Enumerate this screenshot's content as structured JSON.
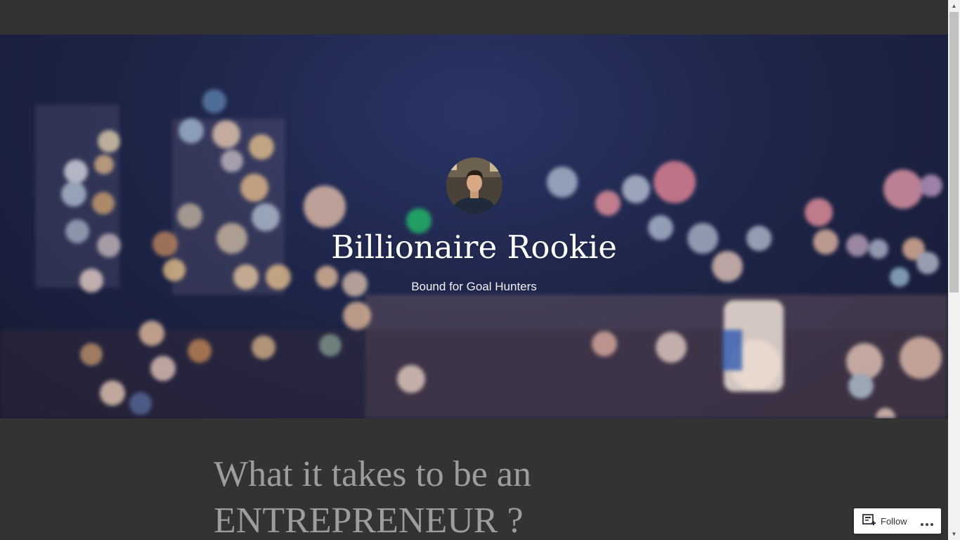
{
  "site": {
    "title": "Billionaire Rookie",
    "tagline": "Bound for Goal Hunters",
    "avatar_icon": "profile-photo"
  },
  "post": {
    "title": "What it takes to be an ENTREPRENEUR ?"
  },
  "follow_widget": {
    "follow_label": "Follow",
    "follow_icon": "reader-follow-icon",
    "more_icon": "ellipsis-icon"
  },
  "colors": {
    "background": "#333333",
    "hero_base": "#1e2549",
    "title_text": "#ffffff",
    "post_title_text": "#9d9d9d"
  }
}
